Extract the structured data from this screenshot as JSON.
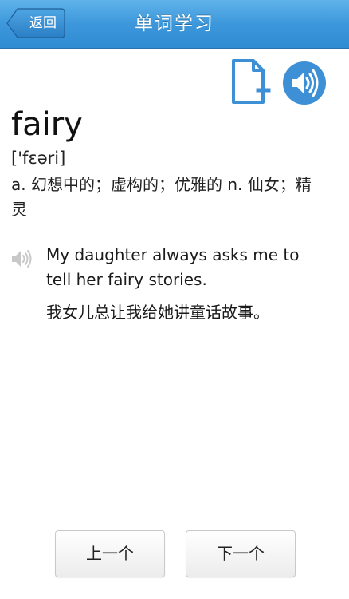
{
  "header": {
    "title": "单词学习",
    "back_label": "返回"
  },
  "actions": {
    "add_note_icon": "add-document-icon",
    "audio_icon": "speaker-icon"
  },
  "entry": {
    "word": "fairy",
    "phonetic": "['fɛəri]",
    "definition": "a. 幻想中的；虚构的；优雅的 n. 仙女；精灵"
  },
  "example": {
    "english": "My daughter always asks me to tell her fairy stories.",
    "chinese": "我女儿总让我给她讲童话故事。",
    "speaker_icon": "speaker-icon"
  },
  "footer": {
    "prev_label": "上一个",
    "next_label": "下一个"
  },
  "colors": {
    "navbar": "#3d97db",
    "accent": "#3d8fd6"
  }
}
